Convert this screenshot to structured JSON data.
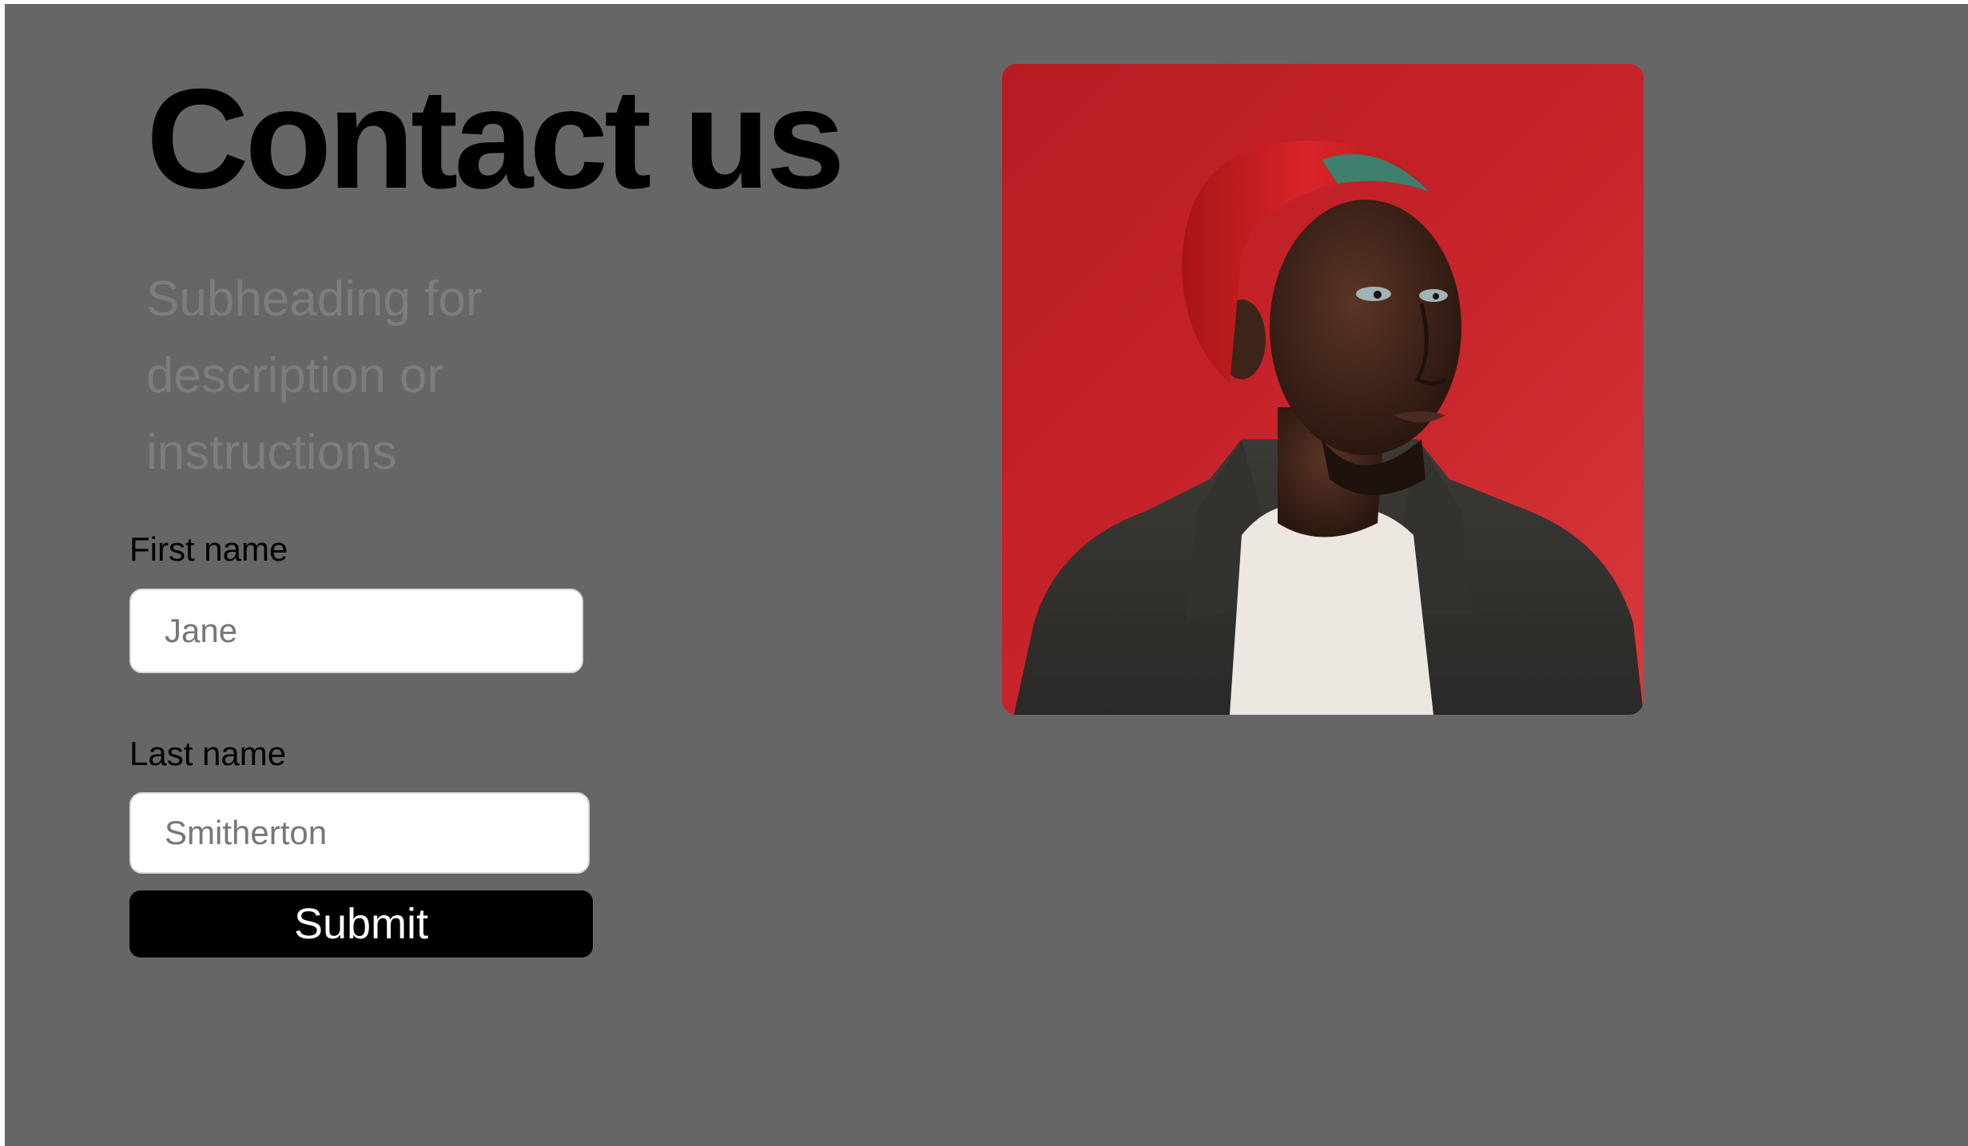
{
  "header": {
    "title": "Contact us",
    "subheading": "Subheading for description or instructions"
  },
  "form": {
    "first_name": {
      "label": "First name",
      "placeholder": "Jane",
      "value": ""
    },
    "last_name": {
      "label": "Last name",
      "placeholder": "Smitherton",
      "value": ""
    },
    "submit_label": "Submit"
  },
  "colors": {
    "page_background": "#666666",
    "title": "#000000",
    "subheading": "#7d7d7d",
    "input_background": "#ffffff",
    "button_background": "#000000",
    "button_text": "#ffffff",
    "photo_background": "#c8242b"
  }
}
